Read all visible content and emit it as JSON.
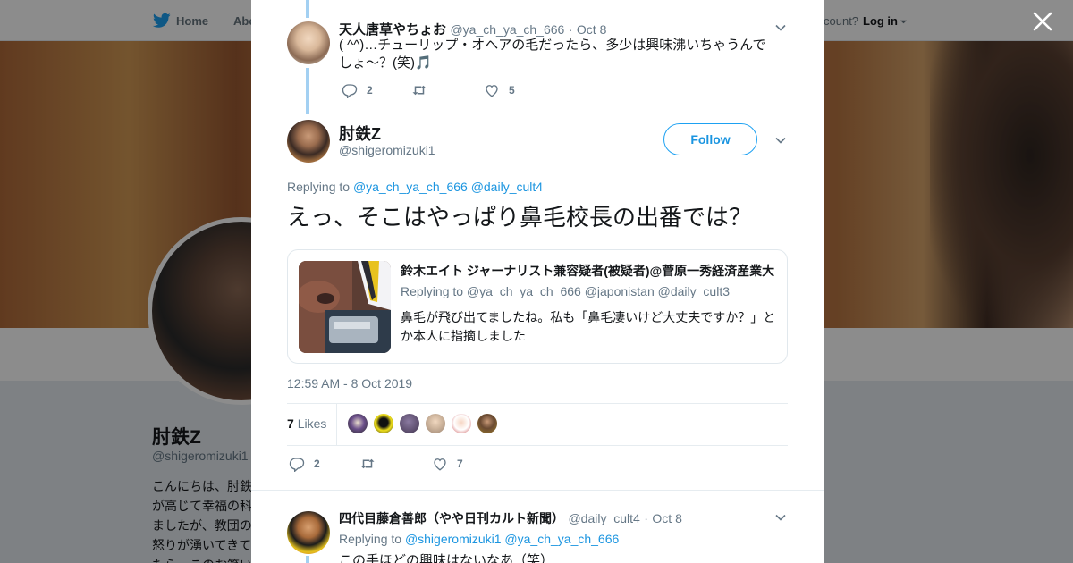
{
  "background": {
    "nav": {
      "home": "Home",
      "about": "Abo",
      "account": "count?",
      "login": "Log in"
    },
    "profile": {
      "name": "肘鉄Z",
      "handle": "@shigeromizuki1",
      "bio": "こんにちは、肘鉄\nが高じて幸福の科\nましたが、教団の\n怒りが湧いてきて\nたら、このお笑い"
    }
  },
  "modal": {
    "parent_tweet": {
      "name": "天人唐草やちょお",
      "handle": "@ya_ch_ya_ch_666",
      "sep": "·",
      "date": "Oct 8",
      "text": "( ^^)…チューリップ・オヘアの毛だったら、多少は興味沸いちゃうんでしょ～？(笑)",
      "emoji": "🎵",
      "replies": "2",
      "retweets": "",
      "likes": "5"
    },
    "main_tweet": {
      "name": "肘鉄Z",
      "handle": "@shigeromizuki1",
      "follow_label": "Follow",
      "replying_to_label": "Replying to",
      "replying_to_1": "@ya_ch_ya_ch_666",
      "replying_to_2": "@daily_cult4",
      "text": "えっ、そこはやっぱり鼻毛校長の出番では？",
      "quote": {
        "author": "鈴木エイト ジャーナリスト兼容疑者(被疑者)@菅原一秀経済産業大",
        "replying_to_label": "Replying to",
        "replying_to_1": "@ya_ch_ya_ch_666",
        "replying_to_2": "@japonistan",
        "replying_to_3": "@daily_cult3",
        "text": "鼻毛が飛び出てましたね。私も「鼻毛凄いけど大丈夫ですか？」とか本人に指摘しました"
      },
      "timestamp": "12:59 AM - 8 Oct 2019",
      "likes_count": "7",
      "likes_label": "Likes",
      "replies": "2",
      "retweets": "",
      "likes": "7"
    },
    "reply_tweet": {
      "name": "四代目藤倉善郎（やや日刊カルト新聞）",
      "handle": "@daily_cult4",
      "sep": "·",
      "date": "Oct 8",
      "replying_to_label": "Replying to",
      "replying_to_1": "@shigeromizuki1",
      "replying_to_2": "@ya_ch_ya_ch_666",
      "text": "この手ほどの興味はないなあ（笑）"
    }
  },
  "colors": {
    "accent": "#1da1f2",
    "link": "#1b95e0",
    "thread_line": "#a3d0f2",
    "muted": "#657786",
    "text": "#14171a"
  }
}
